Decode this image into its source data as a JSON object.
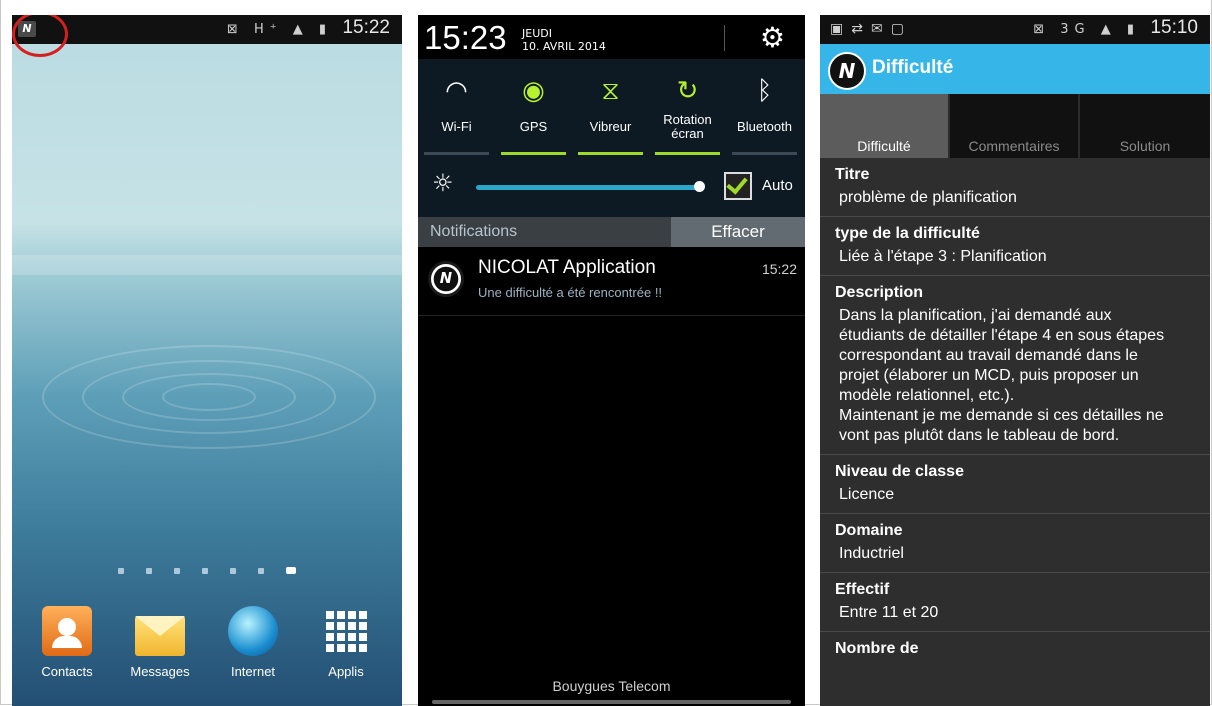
{
  "home_screen": {
    "status": {
      "time": "15:22",
      "icons": "⊠ H⁺ ▲ ▮"
    },
    "notification_icon": "N",
    "page_count": 7,
    "active_page": 7,
    "dock": [
      {
        "label": "Contacts",
        "icon": "contacts-icon"
      },
      {
        "label": "Messages",
        "icon": "messages-icon"
      },
      {
        "label": "Internet",
        "icon": "internet-icon"
      },
      {
        "label": "Applis",
        "icon": "apps-grid-icon"
      }
    ]
  },
  "notification_shade": {
    "time": "15:23",
    "day": "JEUDI",
    "date": "10. AVRIL 2014",
    "settings_icon": "gear-icon",
    "quick_settings": [
      {
        "label": "Wi-Fi",
        "icon": "wifi-icon",
        "active": false
      },
      {
        "label": "GPS",
        "icon": "gps-icon",
        "active": true
      },
      {
        "label": "Vibreur",
        "icon": "vibrate-icon",
        "active": true
      },
      {
        "label": "Rotation écran",
        "icon": "rotation-icon",
        "active": true
      },
      {
        "label": "Bluetooth",
        "icon": "bluetooth-icon",
        "active": false
      }
    ],
    "brightness": {
      "level": 0.97,
      "auto_label": "Auto",
      "auto_checked": true
    },
    "notifications_header": "Notifications",
    "clear_label": "Effacer",
    "notification": {
      "title": "NICOLAT Application",
      "text": "Une difficulté a été rencontrée !!",
      "time": "15:22"
    },
    "carrier": "Bouygues Telecom"
  },
  "detail_screen": {
    "status": {
      "time": "15:10",
      "icons": "⊠ 3G ▲ ▮"
    },
    "app_title": "Difficulté",
    "tabs": [
      {
        "label": "Difficulté",
        "active": true
      },
      {
        "label": "Commentaires",
        "active": false
      },
      {
        "label": "Solution",
        "active": false
      }
    ],
    "fields": [
      {
        "label": "Titre",
        "value": "problème de planification"
      },
      {
        "label": "type de la difficulté",
        "value": "Liée à l'étape 3 : Planification"
      },
      {
        "label": "Description",
        "value": "Dans la planification, j'ai demandé aux\nétudiants de détailler l'étape 4 en sous étapes\ncorrespondant au travail demandé dans le\nprojet (élaborer un MCD, puis proposer un\nmodèle relationnel, etc.).\nMaintenant je me demande si ces détailles ne\nvont pas plutôt dans le tableau de bord."
      },
      {
        "label": "Niveau de classe",
        "value": "Licence"
      },
      {
        "label": "Domaine",
        "value": "Inductriel"
      },
      {
        "label": "Effectif",
        "value": "Entre 11 et 20"
      },
      {
        "label": "Nombre de",
        "value": ""
      }
    ]
  }
}
